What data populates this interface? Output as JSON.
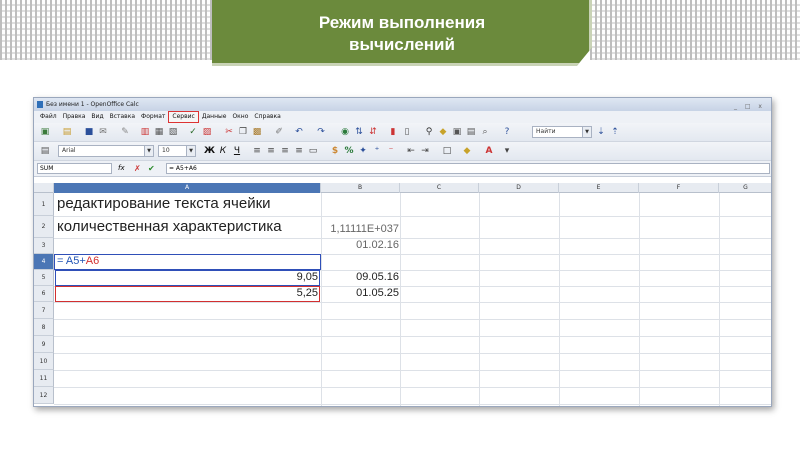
{
  "slide": {
    "title_line1": "Режим выполнения",
    "title_line2": "вычислений"
  },
  "window": {
    "title": "Без имени 1 - OpenOffice Calc",
    "controls": "_ □ x"
  },
  "menu": {
    "items": [
      "Файл",
      "Правка",
      "Вид",
      "Вставка",
      "Формат",
      "Сервис",
      "Данные",
      "Окно",
      "Справка"
    ],
    "highlighted": "Сервис"
  },
  "toolbar": {
    "find_placeholder": "Найти",
    "font_name": "Arial",
    "font_size": "10",
    "bold": "Ж",
    "italic": "К",
    "underline": "Ч"
  },
  "formula_bar": {
    "name_box": "SUM",
    "fx": "fx",
    "cancel": "✗",
    "accept": "✔",
    "formula": "= A5+A6"
  },
  "columns": [
    "A",
    "B",
    "C",
    "D",
    "E",
    "F",
    "G"
  ],
  "rows": [
    "1",
    "2",
    "3",
    "4",
    "5",
    "6",
    "7",
    "8",
    "9",
    "10",
    "11",
    "12"
  ],
  "cells": {
    "a1": "редактирование текста ячейки",
    "a2": "количественная характеристика",
    "b2": "1,11111E+037",
    "b3": "01.02.16",
    "a4_eq": "= ",
    "a4_ref1": "A5",
    "a4_plus": "+",
    "a4_ref2": "A6",
    "a5": "9,05",
    "b5": "09.05.16",
    "a6": "5,25",
    "b6": "01.05.25"
  }
}
